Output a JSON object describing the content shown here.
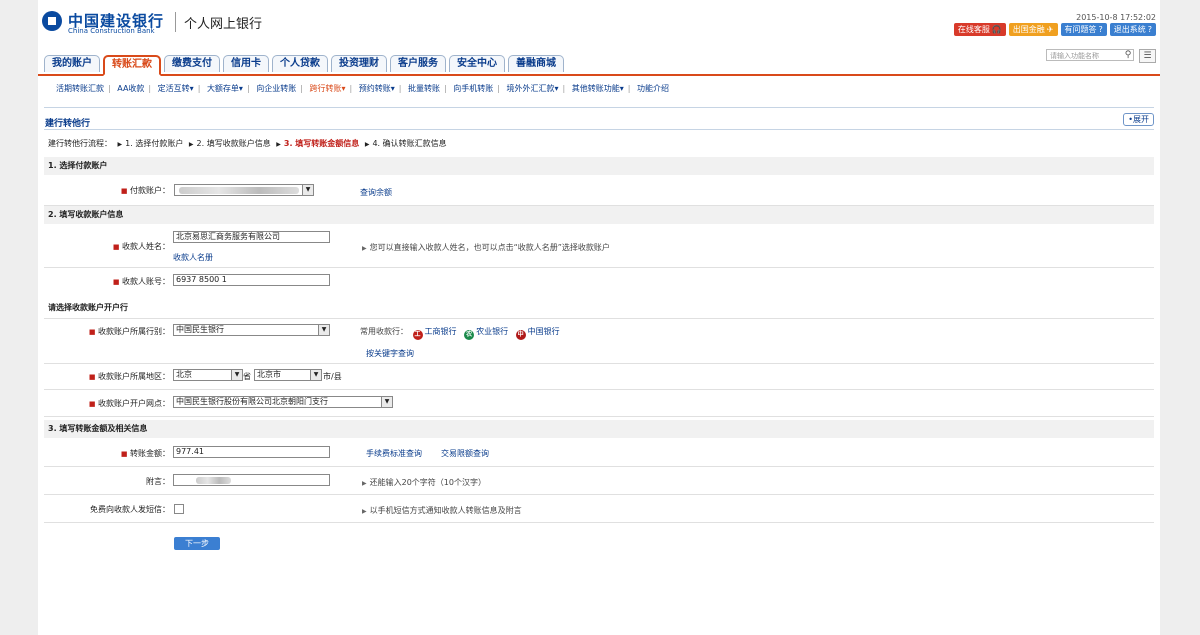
{
  "header": {
    "logo_cn": "中国建设银行",
    "logo_en": "China Construction Bank",
    "subtitle": "个人网上银行",
    "datetime": "2015-10-8 17:52:02",
    "buttons": [
      {
        "label": "在线客服",
        "icon": "headset-icon",
        "color": "#d83a2a"
      },
      {
        "label": "出国金融",
        "icon": "plane-icon",
        "color": "#f0a020"
      },
      {
        "label": "有问题答",
        "icon": "help-icon",
        "color": "#3a7fd0"
      },
      {
        "label": "退出系统",
        "icon": "help-icon",
        "color": "#3a7fd0"
      }
    ]
  },
  "nav": {
    "tabs": [
      "我的账户",
      "转账汇款",
      "缴费支付",
      "信用卡",
      "个人贷款",
      "投资理财",
      "客户服务",
      "安全中心",
      "善融商城"
    ],
    "active_tab": "转账汇款",
    "search_placeholder": "请输入功能名称"
  },
  "subnav": {
    "items": [
      "活期转账汇款",
      "AA收款",
      "定活互转▾",
      "大额存单▾",
      "向企业转账",
      "跨行转账▾",
      "预约转账▾",
      "批量转账",
      "向手机转账",
      "境外外汇汇款▾",
      "其他转账功能▾",
      "功能介绍"
    ],
    "active": "跨行转账▾"
  },
  "page": {
    "title": "建行转他行",
    "expand_label": "•展开",
    "steps_label": "建行转他行流程：",
    "steps": [
      "1. 选择付款账户",
      "2. 填写收款账户信息",
      "3. 填写转账金额信息",
      "4. 确认转账汇款信息"
    ],
    "current_step": 2
  },
  "sections": {
    "s1": "1. 选择付款账户",
    "s2": "2. 填写收款账户信息",
    "s_bank": "请选择收款账户开户行",
    "s3": "3. 填写转账金额及相关信息"
  },
  "form": {
    "payer_label": "付款账户：",
    "check_balance": "查询余额",
    "payee_name_label": "收款人姓名：",
    "payee_name_value": "北京易思汇商务服务有限公司",
    "payee_book_link": "收款人名册",
    "payee_name_hint": "您可以直接输入收款人姓名，也可以点击“收款人名册”选择收款账户",
    "payee_acct_label": "收款人账号：",
    "payee_acct_value": "6937 8500 1",
    "bank_label": "收款账户所属行别：",
    "bank_value": "中国民生银行",
    "common_banks_label": "常用收款行：",
    "common_banks": [
      {
        "name": "工商银行",
        "color": "#c0201a"
      },
      {
        "name": "农业银行",
        "color": "#1a8a4a"
      },
      {
        "name": "中国银行",
        "color": "#b01a1a"
      }
    ],
    "keyword_search": "按关键字查询",
    "region_label": "收款账户所属地区：",
    "province_value": "北京",
    "province_suffix": "省",
    "city_value": "北京市",
    "city_suffix": "市/县",
    "branch_label": "收款账户开户网点：",
    "branch_value": "中国民生银行股份有限公司北京朝阳门支行",
    "amount_label": "转账金额：",
    "amount_value": "977.41",
    "fee_query": "手续费标准查询",
    "limit_query": "交易限额查询",
    "note_label": "附言：",
    "note_hint": "还能输入20个字符（10个汉字）",
    "sms_label": "免费向收款人发短信：",
    "sms_hint": "以手机短信方式通知收款人转账信息及附言",
    "next_button": "下一步"
  }
}
